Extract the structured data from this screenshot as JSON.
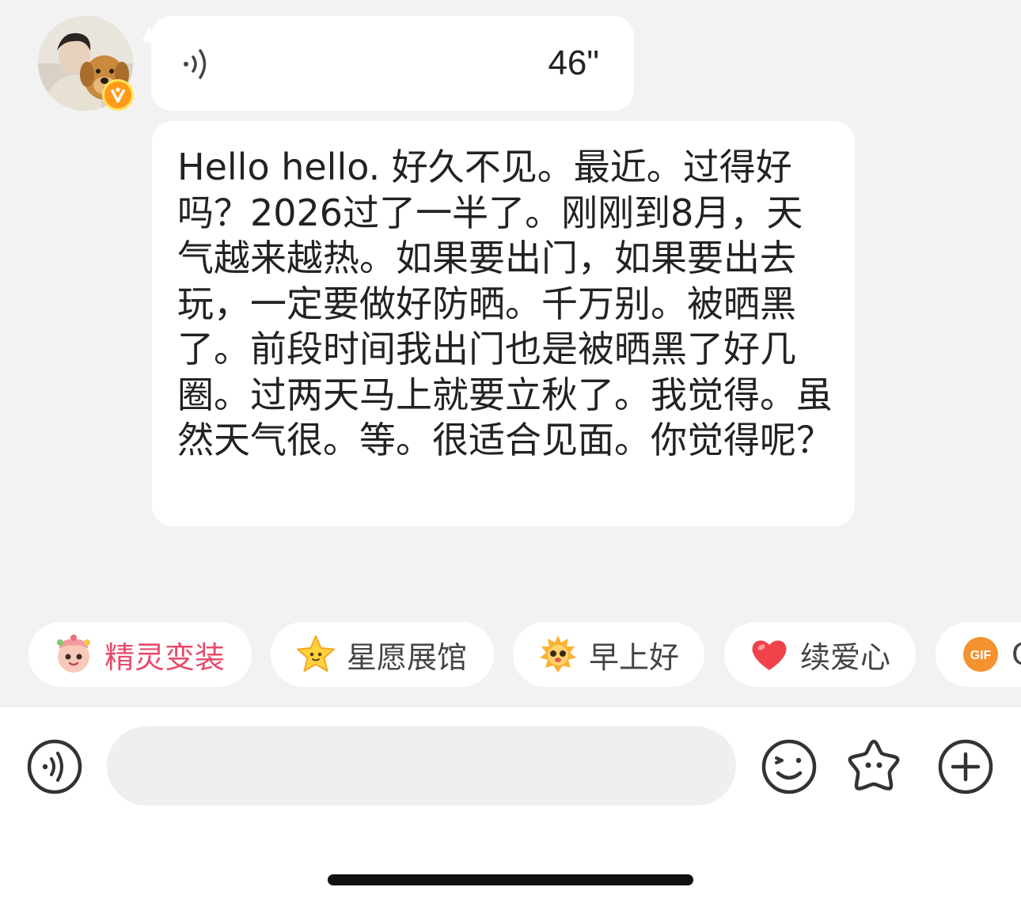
{
  "chat": {
    "sender": {
      "avatar_icon": "user-photo-with-dog",
      "verified_badge_icon": "verified-v-badge",
      "badge_colors": {
        "fill": "#ff9a1a",
        "ring": "#ffe55c"
      }
    },
    "messages": [
      {
        "type": "voice",
        "icon": "sound-wave-icon",
        "duration": "46\""
      },
      {
        "type": "text",
        "text": "Hello hello. 好久不见。最近。过得好吗？2026过了一半了。刚刚到8月，天气越来越热。如果要出门，如果要出去玩，一定要做好防晒。千万别。被晒黑了。前段时间我出门也是被晒黑了好几圈。过两天马上就要立秋了。我觉得。虽然天气很。等。很适合见面。你觉得呢？"
      }
    ]
  },
  "quick_replies": [
    {
      "label": "精灵变装",
      "icon": "sprite-costume-icon",
      "color": "#e84a6a"
    },
    {
      "label": "星愿展馆",
      "icon": "star-icon"
    },
    {
      "label": "早上好",
      "icon": "sun-face-icon"
    },
    {
      "label": "续爱心",
      "icon": "heart-icon",
      "color": "#f0424a"
    },
    {
      "label": "G",
      "icon": "gif-icon"
    }
  ],
  "input_bar": {
    "voice_button_icon": "voice-wave-icon",
    "message_value": "",
    "emoji_button_icon": "smiley-icon",
    "sticker_button_icon": "star-face-icon",
    "more_button_icon": "plus-icon"
  }
}
